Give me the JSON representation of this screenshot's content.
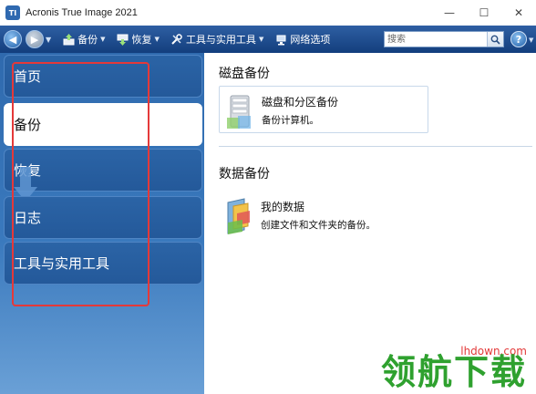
{
  "window": {
    "app_icon": "TI",
    "title": "Acronis True Image 2021",
    "controls": {
      "minimize": "—",
      "maximize": "☐",
      "close": "✕"
    }
  },
  "toolbar": {
    "items": [
      {
        "label": "备份",
        "icon": "backup-icon"
      },
      {
        "label": "恢复",
        "icon": "recover-icon"
      },
      {
        "label": "工具与实用工具",
        "icon": "tools-icon"
      },
      {
        "label": "网络选项",
        "icon": "network-icon"
      }
    ],
    "search": {
      "placeholder": "搜索"
    },
    "help": "?"
  },
  "sidebar": {
    "items": [
      {
        "label": "首页"
      },
      {
        "label": "备份",
        "active": true
      },
      {
        "label": "恢复"
      },
      {
        "label": "日志"
      },
      {
        "label": "工具与实用工具"
      }
    ]
  },
  "content": {
    "sections": [
      {
        "title": "磁盘备份",
        "card": {
          "title": "磁盘和分区备份",
          "subtitle": "备份计算机。",
          "icon": "disk-server-icon"
        }
      },
      {
        "title": "数据备份",
        "card": {
          "title": "我的数据",
          "subtitle": "创建文件和文件夹的备份。",
          "icon": "data-folder-icon"
        }
      }
    ]
  },
  "watermark": {
    "domain": "lhdown.com",
    "text": "领航下载"
  },
  "colors": {
    "sidebar": "#2f6aae",
    "toolbar": "#133e7d",
    "highlight": "#e53939",
    "watermark_green": "#2fa12f"
  }
}
